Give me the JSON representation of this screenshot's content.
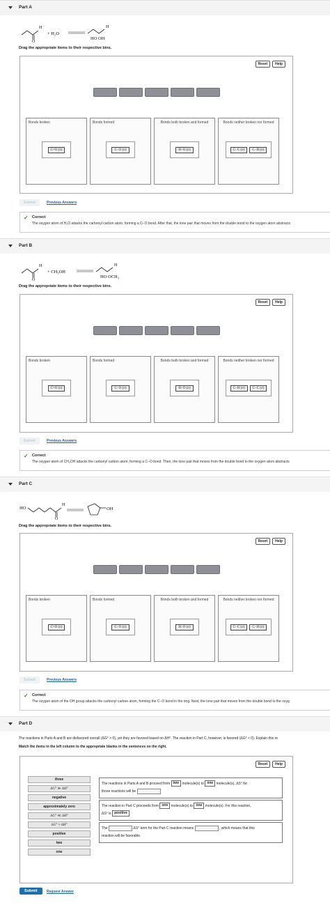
{
  "parts": [
    {
      "title": "Part A",
      "reaction": {
        "reagent": "+ H₂O",
        "product": "HO  OH",
        "H_label": "H",
        "O_label": "O"
      },
      "instruction": "Drag the appropriate items to their respective bins.",
      "reset": "Reset",
      "help": "Help",
      "bins": [
        {
          "label": "Bonds broken",
          "tiles": [
            "C=O (π)"
          ]
        },
        {
          "label": "Bonds formed",
          "tiles": [
            "C−O (σ)"
          ]
        },
        {
          "label": "Bonds both broken and formed",
          "tiles": [
            "H−O (σ)"
          ]
        },
        {
          "label": "Bonds neither broken nor formed",
          "tiles": [
            "C−C (σ)",
            "C−H (σ)"
          ]
        }
      ],
      "submit": "Submit",
      "prev": "Previous Answers",
      "feedback_title": "Correct",
      "feedback_text": "The oxygen atom of H₂O attacks the carbonyl carbon atom, forming a C−O bond. After that, the lone pair that moves from the double bond to the oxygen atom abstracts"
    },
    {
      "title": "Part B",
      "reaction": {
        "reagent": "+ CH₃OH",
        "product": "HO  OCH₃",
        "H_label": "H",
        "O_label": "O"
      },
      "instruction": "Drag the appropriate items to their respective bins.",
      "reset": "Reset",
      "help": "Help",
      "bins": [
        {
          "label": "Bonds broken",
          "tiles": [
            "C=O (π)"
          ]
        },
        {
          "label": "Bonds formed",
          "tiles": [
            "C−O (σ)"
          ]
        },
        {
          "label": "Bonds both broken and formed",
          "tiles": [
            "H−O (σ)"
          ]
        },
        {
          "label": "Bonds neither broken nor formed",
          "tiles": [
            "C−H (σ)",
            "C−C (σ)"
          ]
        }
      ],
      "submit": "Submit",
      "prev": "Previous Answers",
      "feedback_title": "Correct",
      "feedback_text": "The oxygen atom of CH₃OH attacks the carbonyl carbon atom, forming a C−O bond. Then, the lone pair that moves from the double bond to the oxygen atom abstracts"
    },
    {
      "title": "Part C",
      "reaction": {
        "reagent": "HO",
        "product": "OH",
        "H_label": "H",
        "O_label": "O"
      },
      "instruction": "Drag the appropriate items to their respective bins.",
      "reset": "Reset",
      "help": "Help",
      "bins": [
        {
          "label": "Bonds broken",
          "tiles": [
            "C=O (π)"
          ]
        },
        {
          "label": "Bonds formed",
          "tiles": [
            "C−O (σ)"
          ]
        },
        {
          "label": "Bonds both broken and formed",
          "tiles": [
            "H−O (σ)"
          ]
        },
        {
          "label": "Bonds neither broken nor formed",
          "tiles": [
            "C−C (σ)",
            "C−H (σ)"
          ]
        }
      ],
      "submit": "Submit",
      "prev": "Previous Answers",
      "feedback_title": "Correct",
      "feedback_text": "The oxygen atom of the OH group attacks the carbonyl carbon atom, forming the C−O bond in the ring. Next, the lone pair that moves from the double bond to the oxyg"
    }
  ],
  "partD": {
    "title": "Part D",
    "intro": "The reactions in Parts A and B are disfavored overall (ΔG° > 0), yet they are favored based on ΔH°. The reaction in Part C, however, is favored (ΔG° < 0). Explain this re",
    "instruction": "Match the items in the left column to the appropriate blanks in the sentences on the right.",
    "reset": "Reset",
    "help": "Help",
    "options": [
      "three",
      "ΔG° ≫ ΔH°",
      "negative",
      "approximately zero",
      "ΔG° ≪ ΔH°",
      "ΔG° ≈ ΔH°",
      "positive",
      "two",
      "one"
    ],
    "s1": {
      "a": "The reactions in Parts A and B proceed from",
      "f1": "two",
      "b": "molecule(s) to",
      "f2": "one",
      "c": "molecule(s). ΔS° for",
      "d": "those reactions will be"
    },
    "s2": {
      "a": "The reaction in Part C proceeds from",
      "f1": "one",
      "b": "molecule(s) to",
      "f2": "one",
      "c": "molecule(s). For this reaction,",
      "d": "ΔS° is",
      "f3": "positive"
    },
    "s3": {
      "a": "The",
      "b": "ΔS° term for the Part C reaction means",
      "c": ", which means that this",
      "d": "reaction will be favorable."
    },
    "submit": "Submit",
    "request": "Request Answer"
  }
}
